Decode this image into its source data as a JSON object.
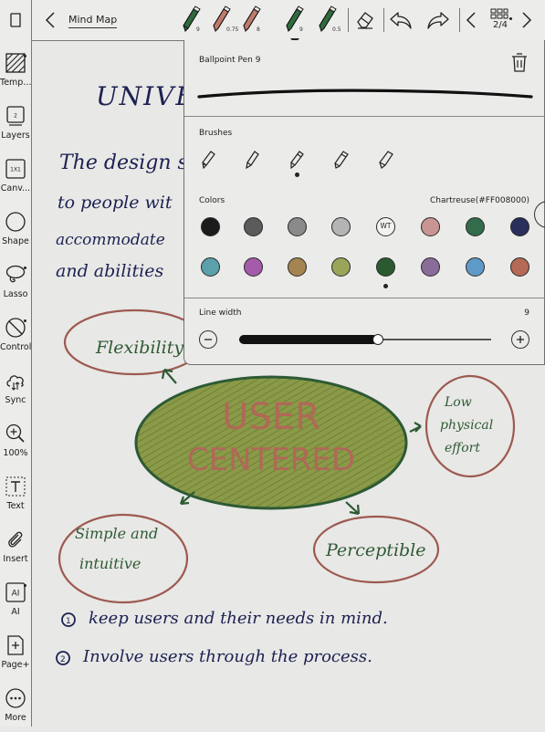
{
  "topbar": {
    "title": "Mind Map",
    "pens": [
      {
        "color": "#2f6b3e",
        "size": "9"
      },
      {
        "color": "#b9756a",
        "size": "0.75"
      },
      {
        "color": "#b9756a",
        "size": "8"
      },
      {
        "color": "#2f6b3e",
        "size": "9",
        "selected": true
      },
      {
        "color": "#2f6b3e",
        "size": "0.5"
      }
    ],
    "page_indicator": "2/4"
  },
  "sidebar": {
    "items": [
      {
        "name": "template",
        "label": "Temp...",
        "icon": "template-icon"
      },
      {
        "name": "layers",
        "label": "Layers",
        "icon": "layers-icon",
        "badge": "2"
      },
      {
        "name": "canvas",
        "label": "Canv...",
        "icon": "canvas-icon",
        "badge": "1X1"
      },
      {
        "name": "shape",
        "label": "Shape",
        "icon": "circle-shape-icon"
      },
      {
        "name": "lasso",
        "label": "Lasso",
        "icon": "lasso-icon"
      },
      {
        "name": "control",
        "label": "Control",
        "icon": "control-icon"
      },
      {
        "name": "sync",
        "label": "Sync",
        "icon": "cloud-sync-icon"
      },
      {
        "name": "zoom",
        "label": "100%",
        "icon": "zoom-icon"
      },
      {
        "name": "text",
        "label": "Text",
        "icon": "text-box-icon"
      },
      {
        "name": "insert",
        "label": "Insert",
        "icon": "paperclip-icon"
      },
      {
        "name": "ai",
        "label": "AI",
        "icon": "ai-icon",
        "badge": "AI"
      },
      {
        "name": "page-add",
        "label": "Page+",
        "icon": "page-add-icon"
      },
      {
        "name": "more",
        "label": "More",
        "icon": "more-dots-icon"
      }
    ]
  },
  "pen_panel": {
    "pen_name": "Ballpoint Pen 9",
    "brushes_label": "Brushes",
    "brushes": [
      "fountain-pen-icon",
      "ballpoint-pen-icon",
      "pencil-icon",
      "marker-icon",
      "highlighter-icon"
    ],
    "selected_brush": 2,
    "colors_label": "Colors",
    "selected_color_name": "Chartreuse(#FF008000)",
    "colors_row1": [
      "#1c1c1c",
      "#5b5b5b",
      "#8a8a8a",
      "#b4b4b4",
      "WT",
      "#c99593",
      "#326c4a",
      "#2b2f5c"
    ],
    "colors_row2": [
      "#5ba0aa",
      "#a55aaa",
      "#a48450",
      "#9aa55a",
      "#2b5a30",
      "#8a6c9a",
      "#5e9ac8",
      "#b46a55"
    ],
    "selected_color_index_row2": 4,
    "line_width_label": "Line width",
    "line_width_value": "9",
    "line_width_fraction": 0.55
  },
  "note": {
    "title": "UNIVER",
    "body_lines": [
      "The design s",
      "to people wit",
      "accommodate",
      "and abilities"
    ],
    "center": [
      "USER",
      "CENTERED"
    ],
    "nodes": [
      "Flexibility",
      "Low physical effort",
      "Simple and intuitive",
      "Perceptible"
    ],
    "points": [
      "keep users and their needs in mind.",
      "Involve users through the process."
    ]
  }
}
